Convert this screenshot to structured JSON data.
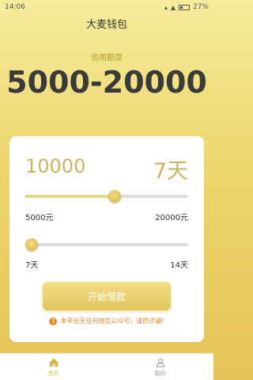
{
  "status": {
    "time": "14:06",
    "battery": "27%"
  },
  "header": {
    "title": "大麦钱包"
  },
  "credit": {
    "label": "信用额度",
    "range": "5000-20000"
  },
  "loan": {
    "amount": "10000",
    "days": "7天",
    "amount_progress": 0.55,
    "days_progress": 0.0,
    "amount_min": "5000元",
    "amount_max": "20000元",
    "days_min": "7天",
    "days_max": "14天",
    "button_label": "开始借款",
    "notice": "本平台无任何微信公众号，谨防诈骗!"
  },
  "tabs": [
    {
      "label": "首页",
      "icon": "home-icon",
      "active": true
    },
    {
      "label": "我的",
      "icon": "user-icon",
      "active": false
    }
  ],
  "colors": {
    "accent": "#e3c45b",
    "warning": "#e0892b",
    "active_tab": "#d8b64c"
  }
}
